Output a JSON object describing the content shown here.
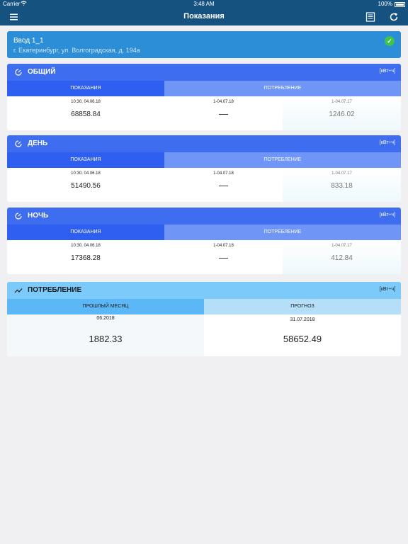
{
  "status": {
    "carrier": "Carrier",
    "time": "3:48 AM",
    "battery": "100%"
  },
  "nav": {
    "title": "Показания"
  },
  "input": {
    "name": "Ввод 1_1",
    "address": "г. Екатеринбург, ул. Волгоградская, д. 194а"
  },
  "sections": [
    {
      "title": "ОБЩИЙ",
      "unit": "[кВт÷ч]",
      "col_readings": "ПОКАЗАНИЯ",
      "col_consumption": "ПОТРЕБЛЕНИЕ",
      "reading_date": "10:30, 04.06.18",
      "reading_value": "68858.84",
      "period_current": "1-04.07.18",
      "current_value": "—",
      "period_prev": "1-04.07.17",
      "prev_value": "1246.02"
    },
    {
      "title": "ДЕНЬ",
      "unit": "[кВт÷ч]",
      "col_readings": "ПОКАЗАНИЯ",
      "col_consumption": "ПОТРЕБЛЕНИЕ",
      "reading_date": "10:30, 04.06.18",
      "reading_value": "51490.56",
      "period_current": "1-04.07.18",
      "current_value": "—",
      "period_prev": "1-04.07.17",
      "prev_value": "833.18"
    },
    {
      "title": "НОЧЬ",
      "unit": "[кВт÷ч]",
      "col_readings": "ПОКАЗАНИЯ",
      "col_consumption": "ПОТРЕБЛЕНИЕ",
      "reading_date": "10:30, 04.06.18",
      "reading_value": "17368.28",
      "period_current": "1-04.07.18",
      "current_value": "—",
      "period_prev": "1-04.07.17",
      "prev_value": "412.84"
    }
  ],
  "consumption": {
    "title": "ПОТРЕБЛЕНИЕ",
    "unit": "[кВт÷ч]",
    "col_last_month": "ПРОШЛЫЙ МЕСЯЦ",
    "col_forecast": "ПРОГНОЗ",
    "last_month_date": "06.2018",
    "last_month_value": "1882.33",
    "forecast_date": "31.07.2018",
    "forecast_value": "58652.49"
  },
  "icons": {
    "menu": "menu-icon",
    "list": "list-icon",
    "refresh": "refresh-icon",
    "meter": "meter-icon",
    "trend": "trend-icon",
    "check": "checkmark-icon"
  },
  "colors": {
    "nav": "#16527f",
    "header": "#3f6df0",
    "consumption_header": "#7ccafa",
    "check": "#3ec44a"
  }
}
